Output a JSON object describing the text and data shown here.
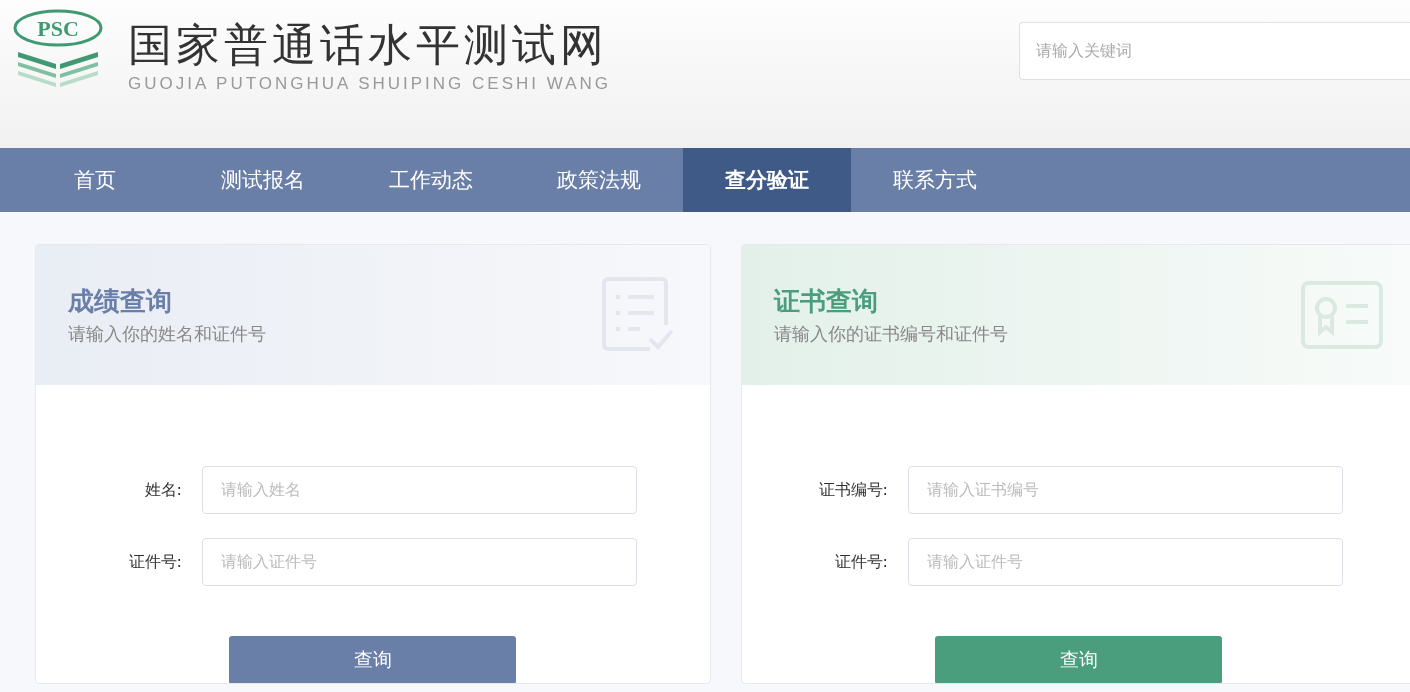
{
  "header": {
    "logo_mark": "PSC",
    "site_title": "国家普通话水平测试网",
    "site_subtitle": "GUOJIA PUTONGHUA SHUIPING CESHI WANG",
    "search": {
      "placeholder": "请输入关键词"
    }
  },
  "nav": [
    {
      "label": "首页",
      "selected": false
    },
    {
      "label": "测试报名",
      "selected": false
    },
    {
      "label": "工作动态",
      "selected": false
    },
    {
      "label": "政策法规",
      "selected": false
    },
    {
      "label": "查分验证",
      "selected": true
    },
    {
      "label": "联系方式",
      "selected": false
    }
  ],
  "cards": [
    {
      "kind": "score",
      "color": "#6a7fa8",
      "title": "成绩查询",
      "subtitle": "请输入你的姓名和证件号",
      "fields": [
        {
          "label": "姓名:",
          "placeholder": "请输入姓名"
        },
        {
          "label": "证件号:",
          "placeholder": "请输入证件号"
        }
      ],
      "button": "查询"
    },
    {
      "kind": "certificate",
      "color": "#4a9e7e",
      "title": "证书查询",
      "subtitle": "请输入你的证书编号和证件号",
      "fields": [
        {
          "label": "证书编号:",
          "placeholder": "请输入证书编号"
        },
        {
          "label": "证件号:",
          "placeholder": "请输入证件号"
        }
      ],
      "button": "查询"
    }
  ]
}
